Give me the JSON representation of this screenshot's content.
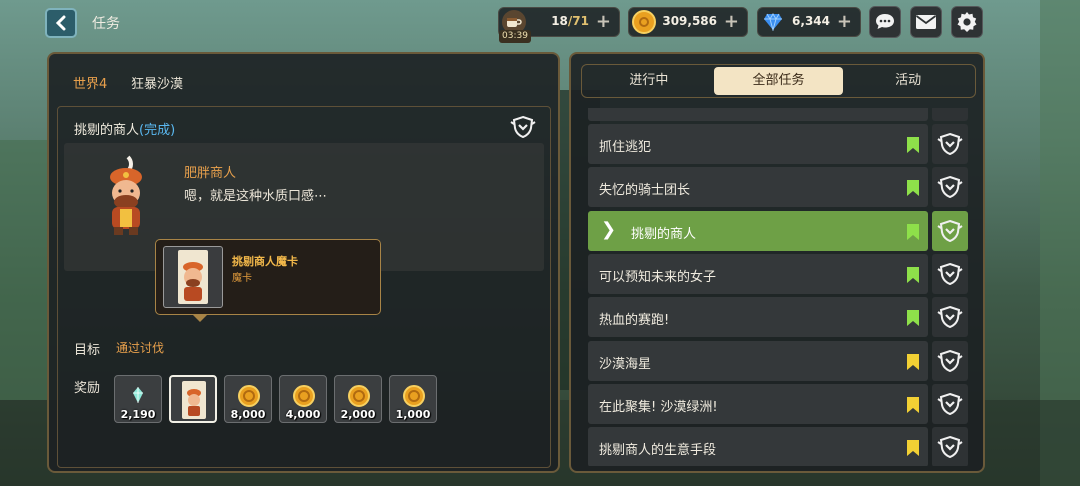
{
  "header": {
    "title": "任务",
    "stamina": {
      "current": "18",
      "max": "/71",
      "timer": "03:39"
    },
    "gold": "309,586",
    "gems": "6,344"
  },
  "quest_detail": {
    "world_label": "世界4",
    "world_name": "狂暴沙漠",
    "title": "挑剔的商人",
    "status": "(完成)",
    "npc_name": "肥胖商人",
    "npc_line": "嗯，就是这种水质口感⋯",
    "goal_label": "目标",
    "goal_text": "通过讨伐",
    "reward_label": "奖励",
    "rewards": [
      {
        "icon": "crystal-icon",
        "qty": "2,190"
      },
      {
        "icon": "card-icon",
        "qty": ""
      },
      {
        "icon": "gold-coin-icon",
        "qty": "8,000"
      },
      {
        "icon": "gold-coin-icon",
        "qty": "4,000"
      },
      {
        "icon": "gold-coin-icon",
        "qty": "2,000"
      },
      {
        "icon": "gold-coin-icon",
        "qty": "1,000"
      }
    ],
    "tooltip": {
      "title": "挑剔商人魔卡",
      "subtitle": "魔卡"
    }
  },
  "quest_tabs": [
    "进行中",
    "全部任务",
    "活动"
  ],
  "active_tab": "全部任务",
  "quest_list": [
    {
      "name": "抓住逃犯",
      "bookmark_color": "#8ee04a"
    },
    {
      "name": "失忆的骑士团长",
      "bookmark_color": "#8ee04a"
    },
    {
      "name": "挑剔的商人",
      "bookmark_color": "#8ee04a",
      "active": true
    },
    {
      "name": "可以预知未来的女子",
      "bookmark_color": "#8ee04a"
    },
    {
      "name": "热血的赛跑!",
      "bookmark_color": "#8ee04a"
    },
    {
      "name": "沙漠海星",
      "bookmark_color": "#f2d034"
    },
    {
      "name": "在此聚集! 沙漠绿洲!",
      "bookmark_color": "#f2d034"
    },
    {
      "name": "挑剔商人的生意手段",
      "bookmark_color": "#f2d034"
    }
  ],
  "colors": {
    "accent_orange": "#e8a04c",
    "active_green": "#6ea046",
    "done_blue": "#5ab8f0"
  }
}
